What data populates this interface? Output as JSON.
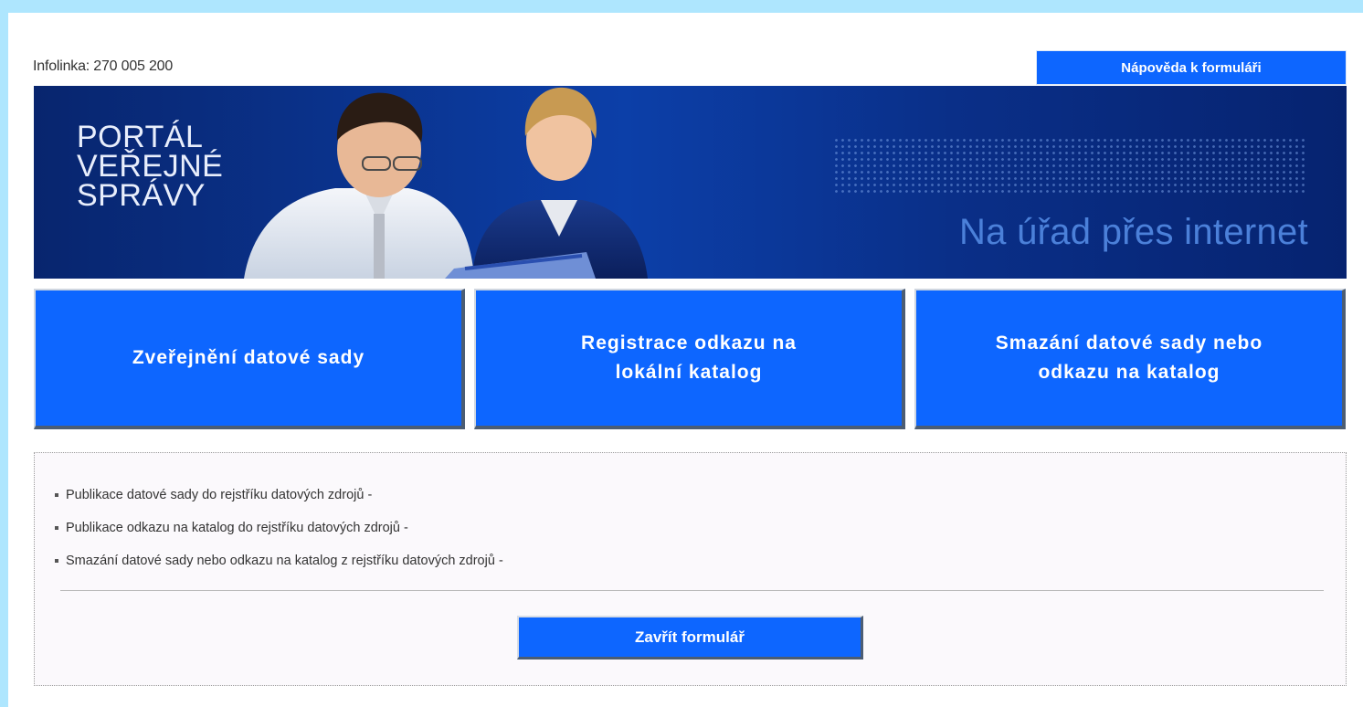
{
  "header": {
    "infoline": "Infolinka: 270 005 200",
    "help_button": "Nápověda k formuláři"
  },
  "banner": {
    "logo_lines": [
      "PORTÁL",
      "VEŘEJNÉ",
      "SPRÁVY"
    ],
    "tagline": "Na úřad přes internet"
  },
  "tiles": [
    {
      "label": "Zveřejnění datové sady"
    },
    {
      "label": "Registrace odkazu na\nlokální katalog"
    },
    {
      "label": "Smazání datové sady nebo\nodkazu na katalog"
    }
  ],
  "content": {
    "items": [
      "Publikace datové sady do rejstříku datových zdrojů -",
      "Publikace odkazu na katalog do rejstříku datových zdrojů -",
      "Smazání datové sady nebo odkazu na katalog z rejstříku datových zdrojů -"
    ],
    "close_button": "Zavřít formulář"
  },
  "colors": {
    "accent": "#0d66ff",
    "background": "#aee6fe",
    "banner": "#0c3fa8"
  }
}
